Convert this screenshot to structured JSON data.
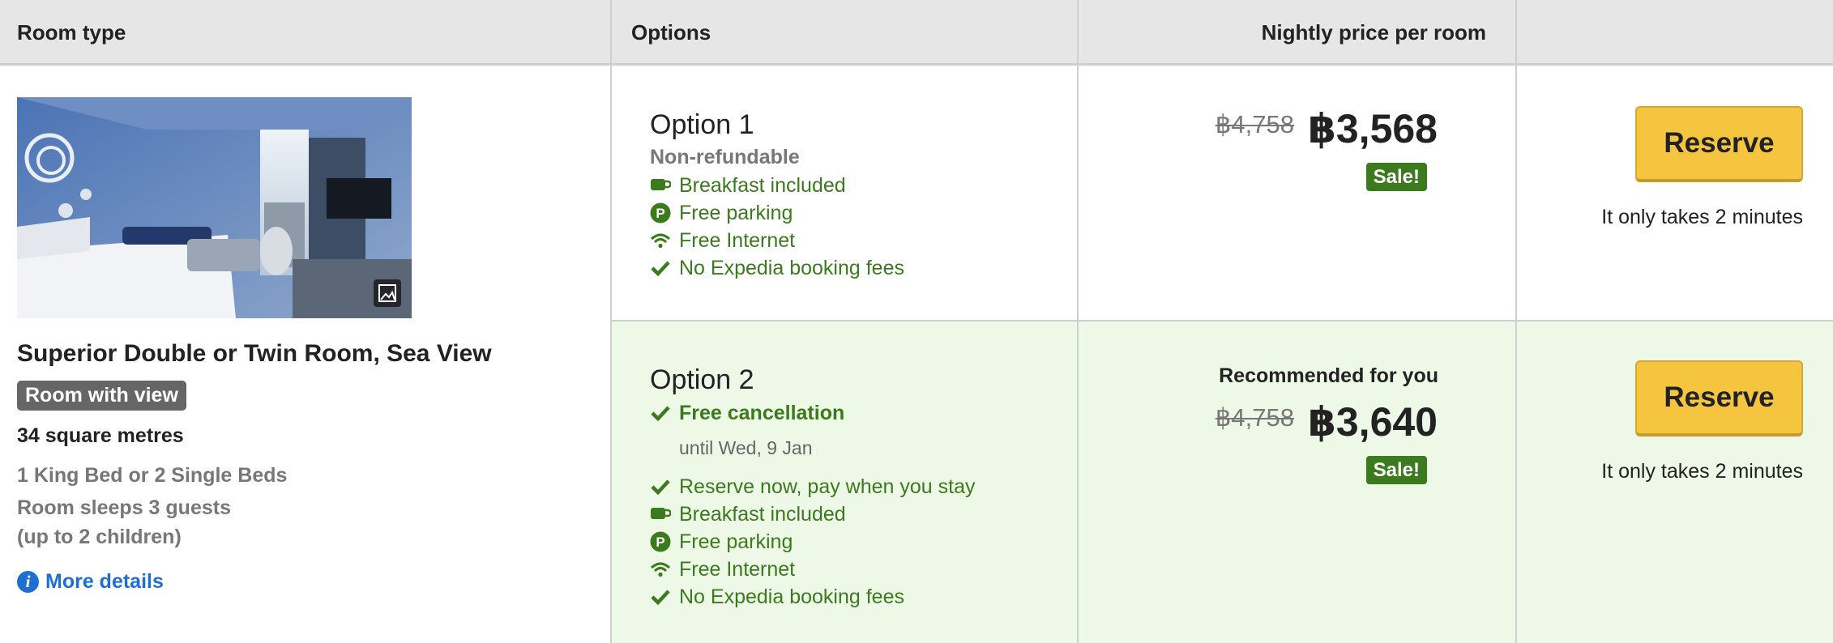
{
  "header": {
    "room_type": "Room type",
    "options": "Options",
    "nightly_price": "Nightly price per room"
  },
  "room": {
    "title": "Superior Double or Twin Room, Sea View",
    "badge": "Room with view",
    "size": "34 square metres",
    "beds": "1 King Bed or 2 Single Beds",
    "sleeps": "Room sleeps 3 guests",
    "children": "(up to 2 children)",
    "more_details": "More details",
    "photo_icon": "photo-gallery-icon"
  },
  "options": [
    {
      "title": "Option 1",
      "policy": "Non-refundable",
      "features": [
        {
          "icon": "coffee-cup-icon",
          "label": "Breakfast included"
        },
        {
          "icon": "parking-icon",
          "label": "Free parking"
        },
        {
          "icon": "wifi-icon",
          "label": "Free Internet"
        },
        {
          "icon": "check-icon",
          "label": "No Expedia booking fees"
        }
      ],
      "original_price": "฿4,758",
      "price": "฿3,568",
      "sale_label": "Sale!",
      "reserve_label": "Reserve",
      "reserve_note": "It only takes 2 minutes"
    },
    {
      "title": "Option 2",
      "highlight": {
        "icon": "check-icon",
        "label": "Free cancellation"
      },
      "until": "until Wed, 9 Jan",
      "features": [
        {
          "icon": "check-icon",
          "label": "Reserve now, pay when you stay"
        },
        {
          "icon": "coffee-cup-icon",
          "label": "Breakfast included"
        },
        {
          "icon": "parking-icon",
          "label": "Free parking"
        },
        {
          "icon": "wifi-icon",
          "label": "Free Internet"
        },
        {
          "icon": "check-icon",
          "label": "No Expedia booking fees"
        }
      ],
      "recommended": "Recommended for you",
      "original_price": "฿4,758",
      "price": "฿3,640",
      "sale_label": "Sale!",
      "reserve_label": "Reserve",
      "reserve_note": "It only takes 2 minutes"
    }
  ],
  "colors": {
    "header_bg": "#e6e6e6",
    "feature_green": "#3c7a1e",
    "option2_bg": "#eef8e7",
    "reserve_yellow": "#f6c540",
    "link_blue": "#1f6fd0"
  }
}
